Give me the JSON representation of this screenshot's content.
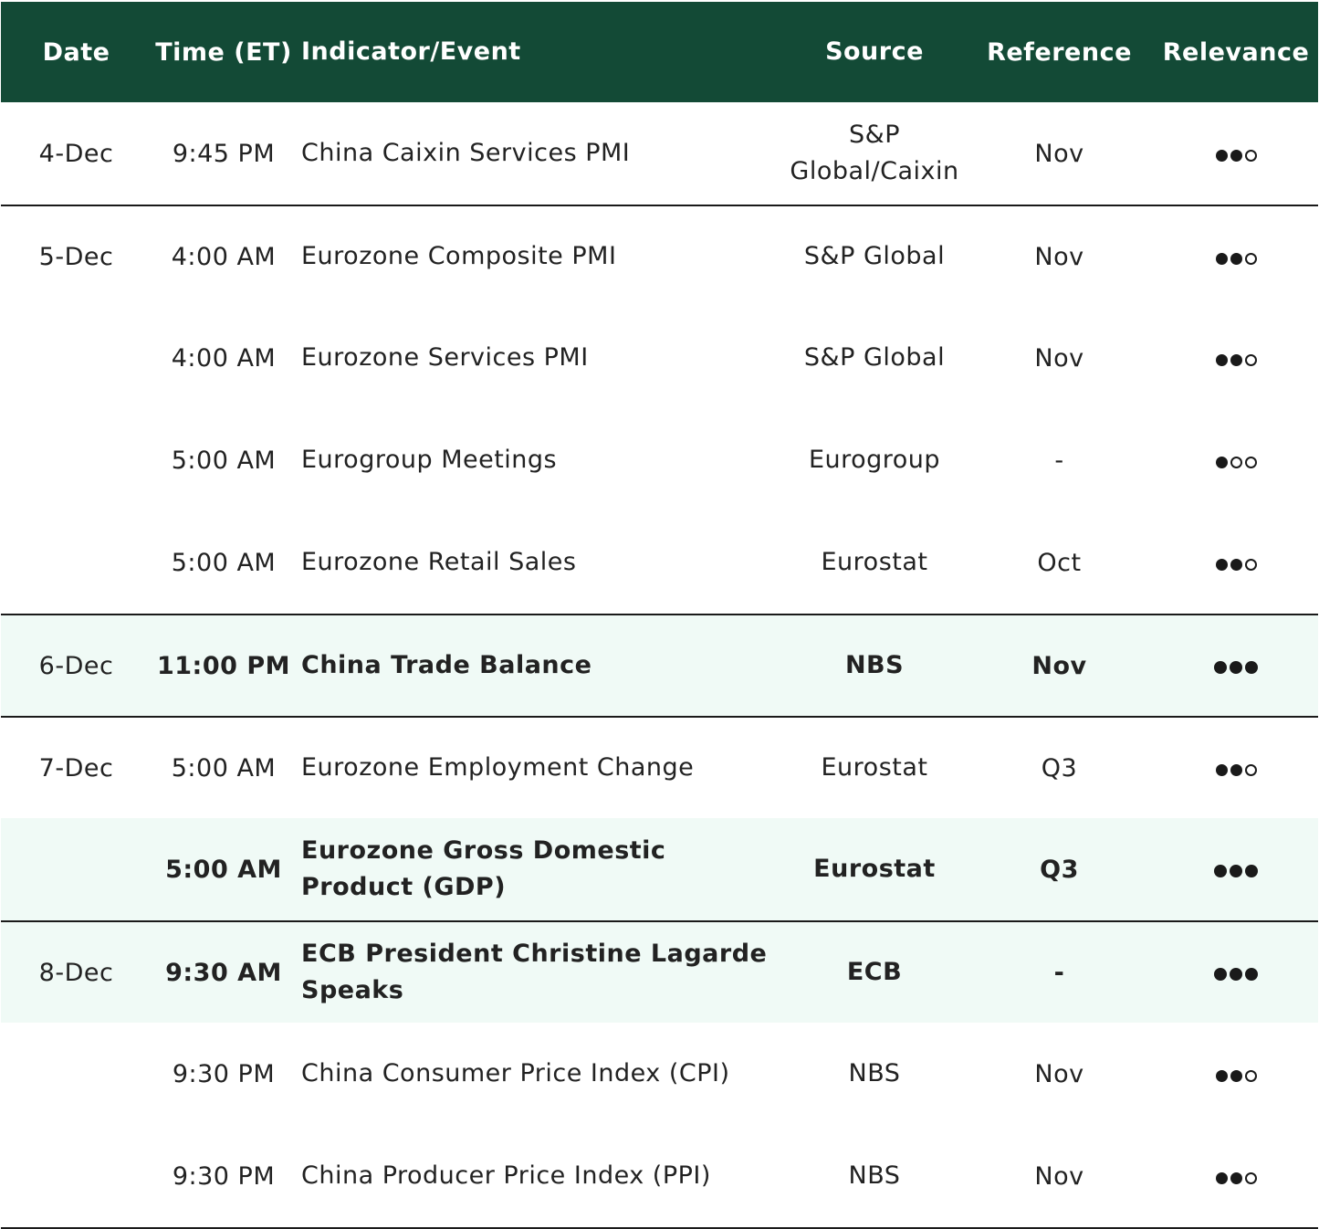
{
  "header": {
    "date": "Date",
    "time": "Time (ET)",
    "indicator": "Indicator/Event",
    "source": "Source",
    "reference": "Reference",
    "relevance": "Relevance"
  },
  "rows": [
    {
      "date": "4-Dec",
      "time": "9:45 PM",
      "indicator": "China Caixin Services PMI",
      "source": "S&P Global/Caixin",
      "reference": "Nov",
      "relevance": 2,
      "highlight": false
    },
    {
      "date": "5-Dec",
      "time": "4:00 AM",
      "indicator": "Eurozone Composite PMI",
      "source": "S&P Global",
      "reference": "Nov",
      "relevance": 2,
      "highlight": false
    },
    {
      "date": "",
      "time": "4:00 AM",
      "indicator": "Eurozone Services PMI",
      "source": "S&P Global",
      "reference": "Nov",
      "relevance": 2,
      "highlight": false
    },
    {
      "date": "",
      "time": "5:00 AM",
      "indicator": "Eurogroup Meetings",
      "source": "Eurogroup",
      "reference": "-",
      "relevance": 1,
      "highlight": false
    },
    {
      "date": "",
      "time": "5:00 AM",
      "indicator": "Eurozone Retail Sales",
      "source": "Eurostat",
      "reference": "Oct",
      "relevance": 2,
      "highlight": false
    },
    {
      "date": "6-Dec",
      "time": "11:00 PM",
      "indicator": "China Trade Balance",
      "source": "NBS",
      "reference": "Nov",
      "relevance": 3,
      "highlight": true
    },
    {
      "date": "7-Dec",
      "time": "5:00 AM",
      "indicator": "Eurozone Employment Change",
      "source": "Eurostat",
      "reference": "Q3",
      "relevance": 2,
      "highlight": false
    },
    {
      "date": "",
      "time": "5:00 AM",
      "indicator": "Eurozone Gross Domestic Product (GDP)",
      "source": "Eurostat",
      "reference": "Q3",
      "relevance": 3,
      "highlight": true
    },
    {
      "date": "8-Dec",
      "time": "9:30 AM",
      "indicator": "ECB President Christine Lagarde Speaks",
      "source": "ECB",
      "reference": "-",
      "relevance": 3,
      "highlight": true
    },
    {
      "date": "",
      "time": "9:30 PM",
      "indicator": "China Consumer Price Index (CPI)",
      "source": "NBS",
      "reference": "Nov",
      "relevance": 2,
      "highlight": false
    },
    {
      "date": "",
      "time": "9:30 PM",
      "indicator": "China Producer Price Index (PPI)",
      "source": "NBS",
      "reference": "Nov",
      "relevance": 2,
      "highlight": false
    }
  ],
  "relevance_max": 3,
  "colors": {
    "header_bg": "#134a36",
    "highlight_bg": "#f0faf6",
    "rule": "#1a1a1a"
  }
}
